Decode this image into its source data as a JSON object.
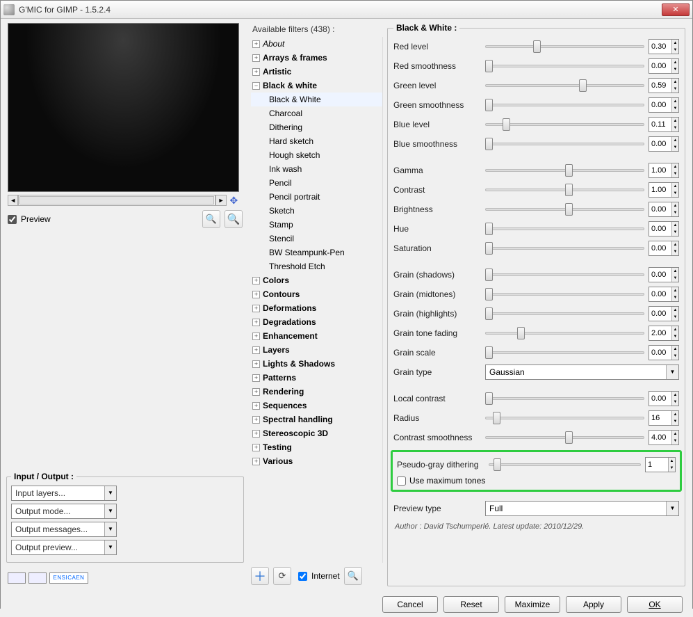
{
  "title": "G'MIC for GIMP - 1.5.2.4",
  "preview_label": "Preview",
  "io": {
    "legend": "Input / Output :",
    "dropdowns": [
      "Input layers...",
      "Output mode...",
      "Output messages...",
      "Output preview..."
    ]
  },
  "tree": {
    "header": "Available filters (438) :",
    "about": "About",
    "categories_top": [
      "Arrays & frames",
      "Artistic"
    ],
    "bw_label": "Black & white",
    "bw_items": [
      "Black & White",
      "Charcoal",
      "Dithering",
      "Hard sketch",
      "Hough sketch",
      "Ink wash",
      "Pencil",
      "Pencil portrait",
      "Sketch",
      "Stamp",
      "Stencil",
      "BW Steampunk-Pen",
      "Threshold Etch"
    ],
    "categories_bottom": [
      "Colors",
      "Contours",
      "Deformations",
      "Degradations",
      "Enhancement",
      "Layers",
      "Lights & Shadows",
      "Patterns",
      "Rendering",
      "Sequences",
      "Spectral handling",
      "Stereoscopic 3D",
      "Testing",
      "Various"
    ],
    "internet_label": "Internet"
  },
  "panel": {
    "legend": "Black & White :",
    "sliders_g1": [
      {
        "label": "Red level",
        "value": "0.30",
        "pos": 30
      },
      {
        "label": "Red smoothness",
        "value": "0.00",
        "pos": 0
      },
      {
        "label": "Green level",
        "value": "0.59",
        "pos": 59
      },
      {
        "label": "Green smoothness",
        "value": "0.00",
        "pos": 0
      },
      {
        "label": "Blue level",
        "value": "0.11",
        "pos": 11
      },
      {
        "label": "Blue smoothness",
        "value": "0.00",
        "pos": 0
      }
    ],
    "sliders_g2": [
      {
        "label": "Gamma",
        "value": "1.00",
        "pos": 50
      },
      {
        "label": "Contrast",
        "value": "1.00",
        "pos": 50
      },
      {
        "label": "Brightness",
        "value": "0.00",
        "pos": 50
      },
      {
        "label": "Hue",
        "value": "0.00",
        "pos": 0
      },
      {
        "label": "Saturation",
        "value": "0.00",
        "pos": 0
      }
    ],
    "sliders_g3": [
      {
        "label": "Grain (shadows)",
        "value": "0.00",
        "pos": 0
      },
      {
        "label": "Grain (midtones)",
        "value": "0.00",
        "pos": 0
      },
      {
        "label": "Grain (highlights)",
        "value": "0.00",
        "pos": 0
      },
      {
        "label": "Grain tone fading",
        "value": "2.00",
        "pos": 20
      },
      {
        "label": "Grain scale",
        "value": "0.00",
        "pos": 0
      }
    ],
    "grain_type_label": "Grain type",
    "grain_type_value": "Gaussian",
    "sliders_g4": [
      {
        "label": "Local contrast",
        "value": "0.00",
        "pos": 0
      },
      {
        "label": "Radius",
        "value": "16",
        "pos": 5
      },
      {
        "label": "Contrast smoothness",
        "value": "4.00",
        "pos": 50
      }
    ],
    "pseudo": {
      "label": "Pseudo-gray dithering",
      "value": "1",
      "pos": 3
    },
    "max_tones": "Use maximum tones",
    "preview_type_label": "Preview type",
    "preview_type_value": "Full",
    "author_prefix": "Author : ",
    "author": "David Tschumperlé.",
    "update_prefix": "      Latest update: ",
    "update": "2010/12/29."
  },
  "footer": {
    "cancel": "Cancel",
    "reset": "Reset",
    "maximize": "Maximize",
    "apply": "Apply",
    "ok": "OK"
  }
}
